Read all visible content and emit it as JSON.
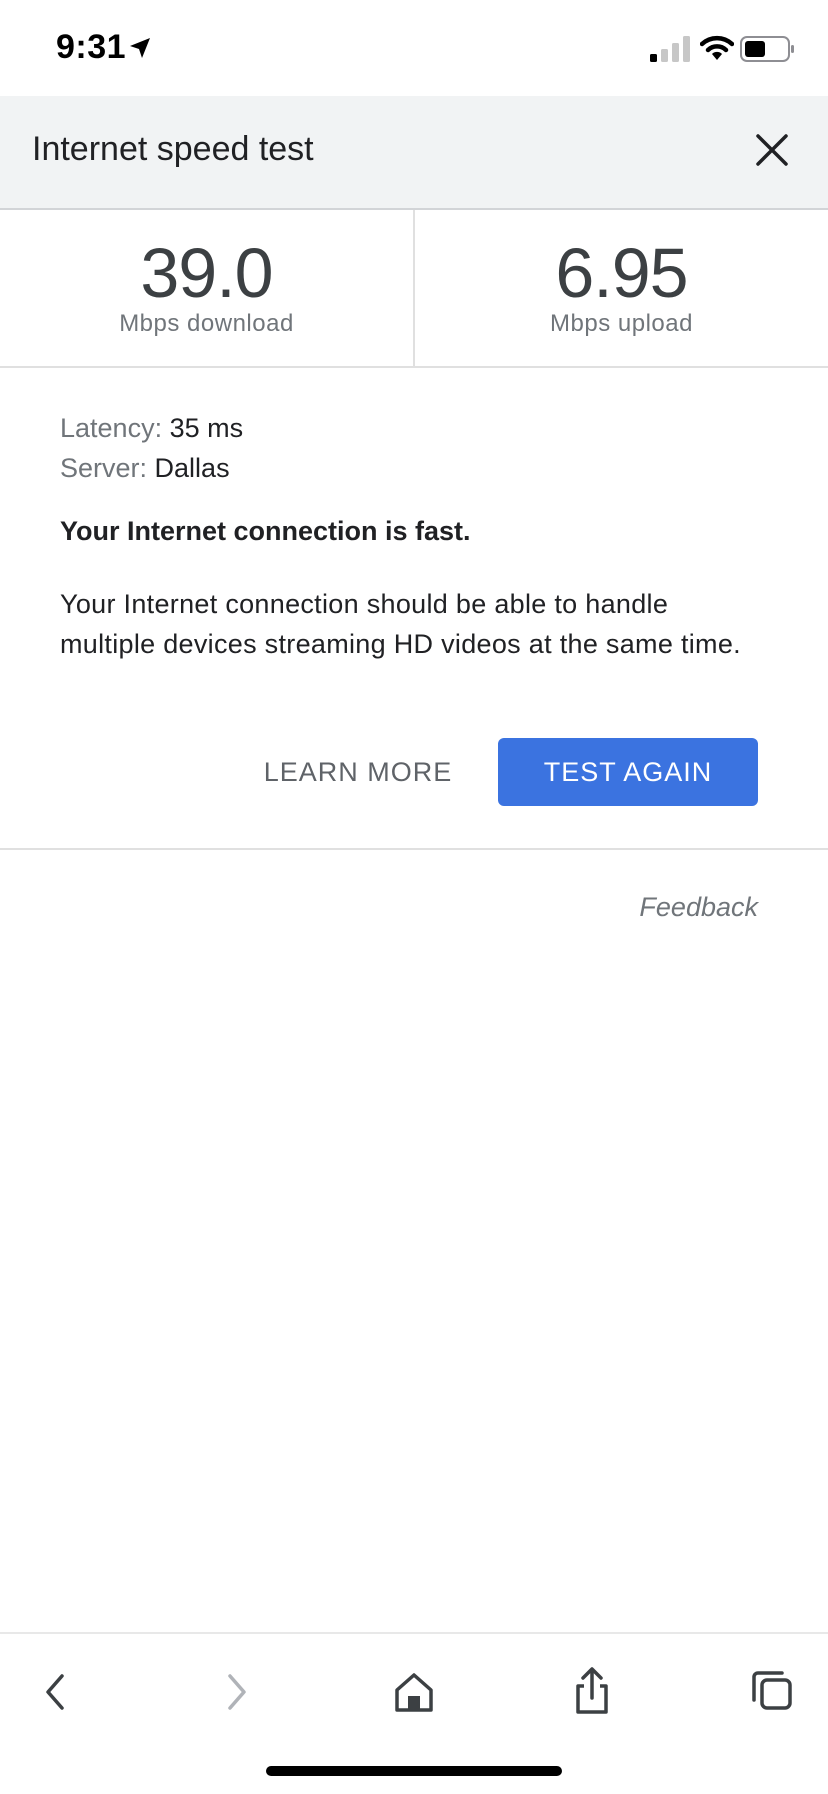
{
  "status_bar": {
    "time": "9:31",
    "icons": [
      "location-arrow-icon",
      "cellular-signal-icon",
      "wifi-icon",
      "battery-icon"
    ]
  },
  "header": {
    "title": "Internet speed test",
    "close_icon": "close-icon"
  },
  "results": {
    "download": {
      "value": "39.0",
      "label": "Mbps download"
    },
    "upload": {
      "value": "6.95",
      "label": "Mbps upload"
    }
  },
  "details": {
    "latency_key": "Latency:",
    "latency_value": "35 ms",
    "server_key": "Server:",
    "server_value": "Dallas"
  },
  "verdict": "Your Internet connection is fast.",
  "description": "Your Internet connection should be able to handle multiple devices streaming HD videos at the same time.",
  "actions": {
    "learn_more": "LEARN MORE",
    "test_again": "TEST AGAIN"
  },
  "feedback": "Feedback",
  "colors": {
    "accent": "#3b73e0",
    "header_bg": "#f1f3f4",
    "muted_text": "#70757a"
  },
  "toolbar": {
    "icons": [
      "back-icon",
      "forward-icon",
      "home-icon",
      "share-icon",
      "tabs-icon"
    ]
  }
}
